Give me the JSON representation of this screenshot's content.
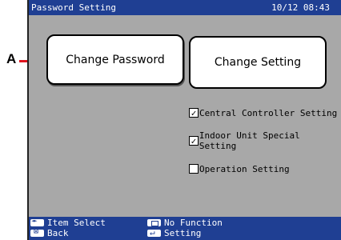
{
  "callout": {
    "label": "A"
  },
  "header": {
    "title": "Password Setting",
    "datetime": "10/12 08:43"
  },
  "buttons": {
    "change_password": "Change Password",
    "change_setting": "Change Setting"
  },
  "options": [
    {
      "label": "Central Controller Setting",
      "checked_mark": "✓"
    },
    {
      "label": "Indoor Unit Special Setting",
      "checked_mark": "✓"
    },
    {
      "label": "Operation Setting",
      "checked_mark": ""
    }
  ],
  "footer": {
    "item_select": "Item Select",
    "back": "Back",
    "no_function": "No Function",
    "setting": "Setting"
  },
  "colors": {
    "titlebar": "#1f3f93",
    "screen_bg": "#a8a8a8",
    "callout_line": "#e0141e"
  }
}
